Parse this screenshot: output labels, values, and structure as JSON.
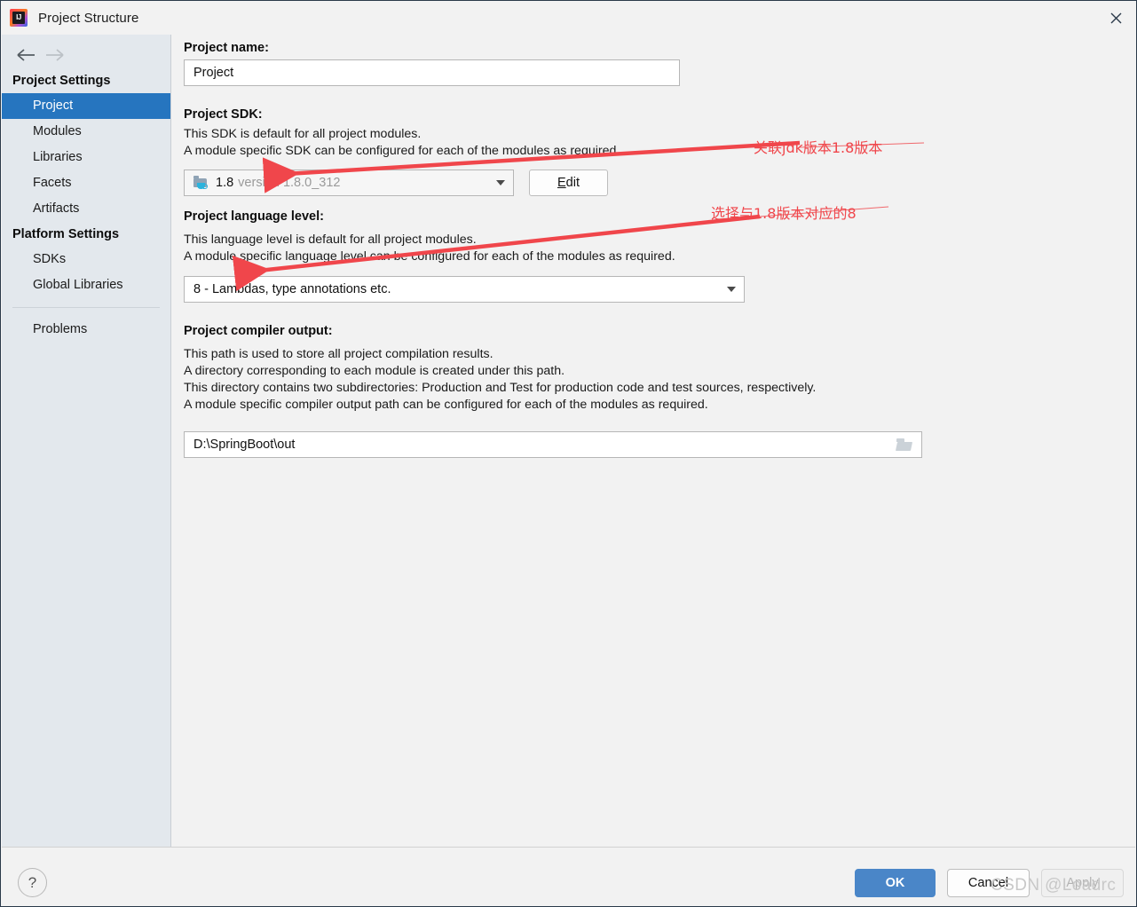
{
  "window": {
    "title": "Project Structure",
    "app_icon": "intellij-idea-icon",
    "close_icon": "close-icon"
  },
  "nav": {
    "back_icon": "arrow-left-icon",
    "forward_icon": "arrow-right-icon"
  },
  "sidebar": {
    "sections": [
      {
        "title": "Project Settings",
        "items": [
          {
            "label": "Project",
            "selected": true
          },
          {
            "label": "Modules",
            "selected": false
          },
          {
            "label": "Libraries",
            "selected": false
          },
          {
            "label": "Facets",
            "selected": false
          },
          {
            "label": "Artifacts",
            "selected": false
          }
        ]
      },
      {
        "title": "Platform Settings",
        "items": [
          {
            "label": "SDKs",
            "selected": false
          },
          {
            "label": "Global Libraries",
            "selected": false
          }
        ]
      }
    ],
    "problems_label": "Problems"
  },
  "main": {
    "project_name": {
      "label": "Project name:",
      "value": "Project"
    },
    "project_sdk": {
      "label": "Project SDK:",
      "desc_line1": "This SDK is default for all project modules.",
      "desc_line2": "A module specific SDK can be configured for each of the modules as required.",
      "icon": "java-sdk-folder-icon",
      "value_name": "1.8",
      "value_version": "version 1.8.0_312",
      "dropdown_icon": "chevron-down-icon",
      "edit_button": {
        "mnemonic": "E",
        "rest": "dit"
      }
    },
    "language_level": {
      "label": "Project language level:",
      "desc_line1": "This language level is default for all project modules.",
      "desc_line2": "A module specific language level can be configured for each of the modules as required.",
      "value": "8 - Lambdas, type annotations etc.",
      "dropdown_icon": "chevron-down-icon"
    },
    "compiler_output": {
      "label": "Project compiler output:",
      "desc_line1": "This path is used to store all project compilation results.",
      "desc_line2": "A directory corresponding to each module is created under this path.",
      "desc_line3": "This directory contains two subdirectories: Production and Test for production code and test sources, respectively.",
      "desc_line4": "A module specific compiler output path can be configured for each of the modules as required.",
      "value": "D:\\SpringBoot\\out",
      "browse_icon": "folder-browse-icon"
    }
  },
  "annotations": {
    "color": "#f0464b",
    "items": [
      {
        "text": "关联jdk版本1.8版本"
      },
      {
        "text": "选择与1.8版本对应的8"
      }
    ]
  },
  "footer": {
    "help_icon": "?",
    "ok_label": "OK",
    "cancel_label": "Cancel",
    "apply_label": "Apply",
    "ok_color": "#4a86c8"
  },
  "watermark": {
    "text": "CSDN @Loadrc"
  }
}
